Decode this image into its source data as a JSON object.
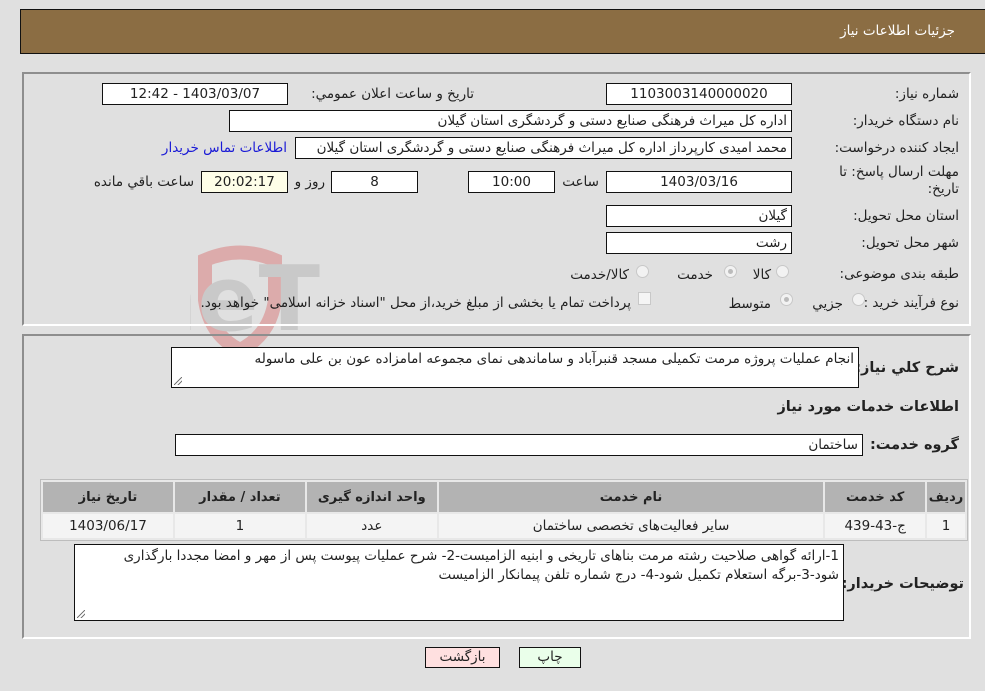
{
  "header": {
    "title": "جزئیات اطلاعات نیاز"
  },
  "form": {
    "need_number": {
      "label": "شماره نیاز:",
      "value": "1103003140000020"
    },
    "announce_datetime": {
      "label": "تاریخ و ساعت اعلان عمومي:",
      "value": "1403/03/07 - 12:42"
    },
    "buyer_org": {
      "label": "نام دستگاه خريدار:",
      "value": "اداره کل میراث فرهنگی  صنایع دستی و گردشگری استان گیلان"
    },
    "requester": {
      "label": "ايجاد کننده درخواست:",
      "value": "محمد امیدی کارپرداز اداره کل میراث فرهنگی  صنایع دستی و گردشگری استان گیلان",
      "contact_link": "اطلاعات تماس خريدار"
    },
    "deadline": {
      "label": "مهلت ارسال پاسخ: تا تاريخ:",
      "date": "1403/03/16",
      "time_label": "ساعت",
      "time": "10:00",
      "days": "8",
      "days_label": "روز و",
      "remaining": "20:02:17",
      "remaining_label": "ساعت باقي مانده"
    },
    "province": {
      "label": "استان محل تحويل:",
      "value": "گیلان"
    },
    "city": {
      "label": "شهر محل تحويل:",
      "value": "رشت"
    },
    "category": {
      "label": "طبقه بندی موضوعی:",
      "options": [
        "کالا",
        "خدمت",
        "کالا/خدمت"
      ],
      "selected": "خدمت"
    },
    "purchase_type": {
      "label": "نوع فرآيند خريد :",
      "options": [
        "جزيي",
        "متوسط"
      ],
      "selected": "متوسط",
      "treasury_note": "پرداخت تمام يا بخشی از مبلغ خريد،از محل \"اسناد خزانه اسلامی\" خواهد بود."
    }
  },
  "details": {
    "description_label": "شرح کلي نياز:",
    "description": "انجام عملیات پروژه مرمت تکمیلی مسجد قنبرآباد و ساماندهی نمای مجموعه امامزاده عون بن علی ماسوله",
    "services_heading": "اطلاعات خدمات مورد نياز",
    "service_group_label": "گروه خدمت:",
    "service_group": "ساختمان",
    "table": {
      "headers": [
        "رديف",
        "کد خدمت",
        "نام خدمت",
        "واحد اندازه گيری",
        "تعداد / مقدار",
        "تاريخ نياز"
      ],
      "rows": [
        [
          "1",
          "ج-43-439",
          "سایر فعالیت‌های تخصصی ساختمان",
          "عدد",
          "1",
          "1403/06/17"
        ]
      ]
    },
    "buyer_notes_label": "توضيحات خريدار:",
    "buyer_notes": "1-ارائه گواهی صلاحیت رشته مرمت بناهای تاریخی و ابنیه الزامیست-2- شرح عملیات پیوست پس از مهر و امضا مجددا بارگذاری شود-3-برگه استعلام تکمیل شود-4- درج شماره تلفن پیمانکار الزامیست"
  },
  "buttons": {
    "print": "چاپ",
    "back": "بازگشت"
  },
  "colors": {
    "header_bg": "#8b6d43",
    "print_bg": "#eaffea",
    "back_bg": "#ffe0e0",
    "link": "#1a1ad6"
  }
}
